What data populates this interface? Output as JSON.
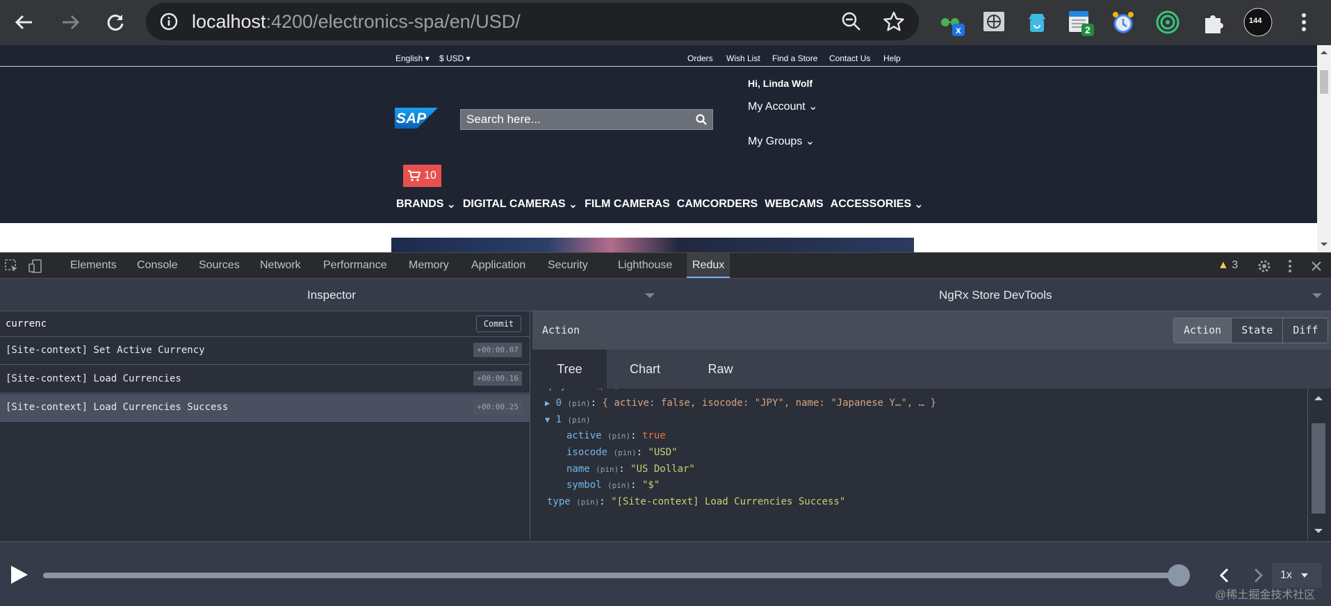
{
  "browser": {
    "url_host": "localhost",
    "url_rest": ":4200/electronics-spa/en/USD/",
    "extension_badges": {
      "x_badge": "x",
      "calendar_badge": "2",
      "avatar_count": "144"
    }
  },
  "site": {
    "language": "English",
    "currency": "$ USD",
    "top_links": [
      "Orders",
      "Wish List",
      "Find a Store",
      "Contact Us",
      "Help"
    ],
    "greeting": "Hi, Linda Wolf",
    "my_account": "My Account",
    "my_groups": "My Groups",
    "logo_text": "SAP",
    "search_placeholder": "Search here...",
    "cart_count": "10",
    "nav": [
      {
        "label": "BRANDS",
        "dropdown": true
      },
      {
        "label": "DIGITAL CAMERAS",
        "dropdown": true
      },
      {
        "label": "FILM CAMERAS",
        "dropdown": false
      },
      {
        "label": "CAMCORDERS",
        "dropdown": false
      },
      {
        "label": "WEBCAMS",
        "dropdown": false
      },
      {
        "label": "ACCESSORIES",
        "dropdown": true
      }
    ]
  },
  "devtools": {
    "tabs": [
      "Elements",
      "Console",
      "Sources",
      "Network",
      "Performance",
      "Memory",
      "Application",
      "Security",
      "Lighthouse",
      "Redux"
    ],
    "active_tab": "Redux",
    "warnings": "3"
  },
  "redux": {
    "left_title": "Inspector",
    "right_title": "NgRx Store DevTools",
    "filter_value": "currenc",
    "commit_label": "Commit",
    "actions": [
      {
        "name": "[Site-context] Set Active Currency",
        "time": "+00:00.07"
      },
      {
        "name": "[Site-context] Load Currencies",
        "time": "+00:00.16"
      },
      {
        "name": "[Site-context] Load Currencies Success",
        "time": "+00:00.25",
        "selected": true
      }
    ],
    "action_title": "Action",
    "modes": [
      "Action",
      "State",
      "Diff"
    ],
    "active_mode": "Action",
    "sub_tabs": [
      "Tree",
      "Chart",
      "Raw"
    ],
    "active_sub_tab": "Tree",
    "tree": {
      "payload_key": "payload",
      "item0_key": "0",
      "item0_summary": "{ active: false, isocode: \"JPY\", name: \"Japanese Y…\", … }",
      "item1_key": "1",
      "pin": "(pin)",
      "active_key": "active",
      "active_val": "true",
      "isocode_key": "isocode",
      "isocode_val": "\"USD\"",
      "name_key": "name",
      "name_val": "\"US Dollar\"",
      "symbol_key": "symbol",
      "symbol_val": "\"$\"",
      "type_key": "type",
      "type_val": "\"[Site-context] Load Currencies Success\""
    },
    "speed": "1x",
    "slider_position_percent": 100
  },
  "watermark": "@稀土掘金技术社区",
  "colors": {
    "site_header": "#1f2433",
    "cart": "#e8504f",
    "devtools_accent": "#7cacf8",
    "string_value": "#c8d36e",
    "boolean_value": "#e8763c",
    "tree_key": "#76b6e6"
  }
}
